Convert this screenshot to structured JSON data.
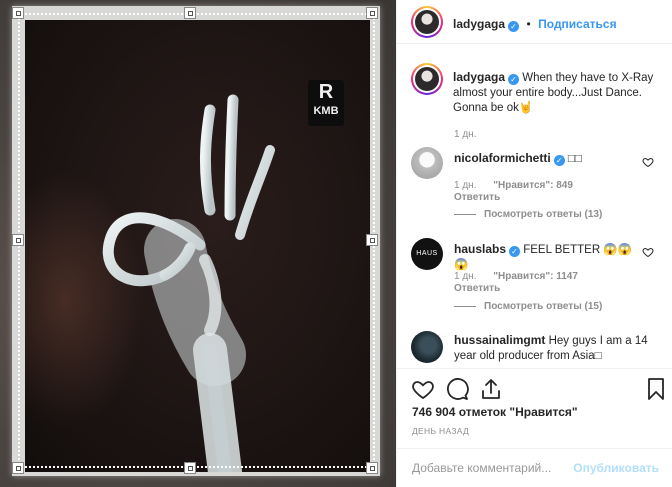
{
  "post": {
    "username": "ladygaga",
    "dot": "•",
    "follow_label": "Подписаться",
    "marker_letter": "R",
    "marker_text": "KMB"
  },
  "caption": {
    "username": "ladygaga",
    "text": "When they have to X-Ray almost your entire body...Just Dance. Gonna be ok",
    "emoji": "🤘",
    "time": "1 дн."
  },
  "comments": [
    {
      "username": "nicolaformichetti",
      "text": "□□",
      "time": "1 дн.",
      "likes": "\"Нравится\": 849",
      "reply": "Ответить",
      "view_replies": "Посмотреть ответы (13)"
    },
    {
      "username": "hauslabs",
      "text": "FEEL BETTER 😱😱😱",
      "time": "1 дн.",
      "likes": "\"Нравится\": 1147",
      "reply": "Ответить",
      "view_replies": "Посмотреть ответы (15)",
      "avatar_text": "HAUS"
    },
    {
      "username": "hussainalimgmt",
      "text": "Hey guys I am a 14 year old producer from Asia□"
    }
  ],
  "footer": {
    "likes": "746 904 отметок \"Нравится\"",
    "time_ago": "ДЕНЬ НАЗАД",
    "comment_placeholder": "Добавьте комментарий...",
    "publish_label": "Опубликовать"
  },
  "icons": {
    "heart": "heart-icon",
    "comment": "comment-icon",
    "share": "share-icon",
    "bookmark": "bookmark-icon"
  },
  "colors": {
    "link_blue": "#3897f0",
    "publish_disabled": "#b2dffc",
    "muted": "#8e8e8e"
  }
}
